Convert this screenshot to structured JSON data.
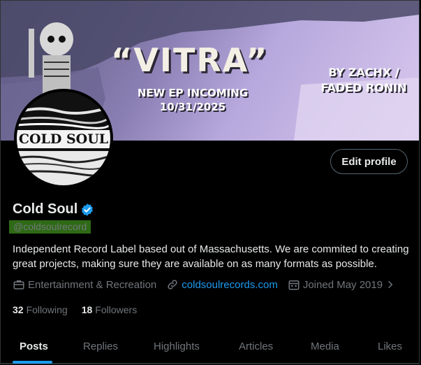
{
  "banner": {
    "title": "“VITRA”",
    "subtitle_line1": "NEW EP INCOMING",
    "subtitle_line2": "10/31/2025",
    "credit_line1": "BY ZACHX /",
    "credit_line2": "FADED RONIN"
  },
  "avatar": {
    "label": "COLD SOUL"
  },
  "profile": {
    "edit_label": "Edit profile",
    "name": "Cold Soul",
    "handle": "@coldsoulrecord",
    "bio": "Independent Record Label based out of Massachusetts. We are commited to creating great projects, making sure they are available on as many formats as possible.",
    "category": "Entertainment & Recreation",
    "website": "coldsoulrecords.com",
    "joined": "Joined May 2019",
    "following_count": "32",
    "following_label": "Following",
    "followers_count": "18",
    "followers_label": "Followers"
  },
  "tabs": [
    "Posts",
    "Replies",
    "Highlights",
    "Articles",
    "Media",
    "Likes"
  ],
  "colors": {
    "accent": "#1d9bf0",
    "handle_highlight": "#2e6a15",
    "muted": "#71767b"
  }
}
